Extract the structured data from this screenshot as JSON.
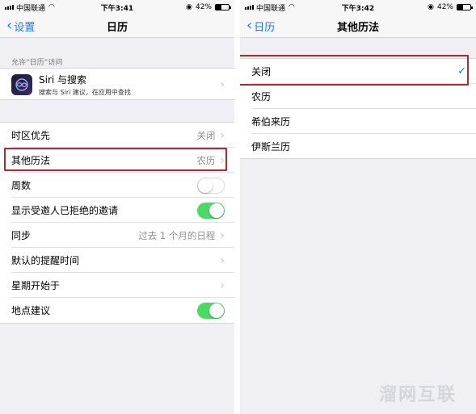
{
  "left_screen": {
    "status": {
      "carrier": "中国联通",
      "time": "下午3:41",
      "battery": "42%"
    },
    "nav": {
      "back_label": "设置",
      "title": "日历"
    },
    "section_label": "允许“日历”访问",
    "siri": {
      "title": "Siri 与搜索",
      "subtitle": "搜索与 Siri 建议，在应用中查找"
    },
    "rows": [
      {
        "label": "时区优先",
        "value": "关闭"
      },
      {
        "label": "其他历法",
        "value": "农历"
      },
      {
        "label": "周数",
        "toggle": "off"
      },
      {
        "label": "显示受邀人已拒绝的邀请",
        "toggle": "on"
      },
      {
        "label": "同步",
        "value": "过去 1 个月的日程"
      },
      {
        "label": "默认的提醒时间",
        "value": ""
      },
      {
        "label": "星期开始于",
        "value": ""
      },
      {
        "label": "地点建议",
        "toggle": "on"
      }
    ]
  },
  "right_screen": {
    "status": {
      "carrier": "中国联通",
      "time": "下午3:42",
      "battery": "42%"
    },
    "nav": {
      "back_label": "日历",
      "title": "其他历法"
    },
    "options": [
      {
        "label": "关闭",
        "selected": true
      },
      {
        "label": "农历",
        "selected": false
      },
      {
        "label": "希伯来历",
        "selected": false
      },
      {
        "label": "伊斯兰历",
        "selected": false
      }
    ]
  },
  "watermark": "溜网互联",
  "colors": {
    "accent": "#1a78f2",
    "toggle_on": "#4cd964",
    "highlight": "#b8262a"
  },
  "icons": [
    "signal-icon",
    "wifi-icon",
    "battery-icon",
    "chevron-left-icon",
    "chevron-right-icon",
    "siri-icon",
    "checkmark-icon"
  ]
}
